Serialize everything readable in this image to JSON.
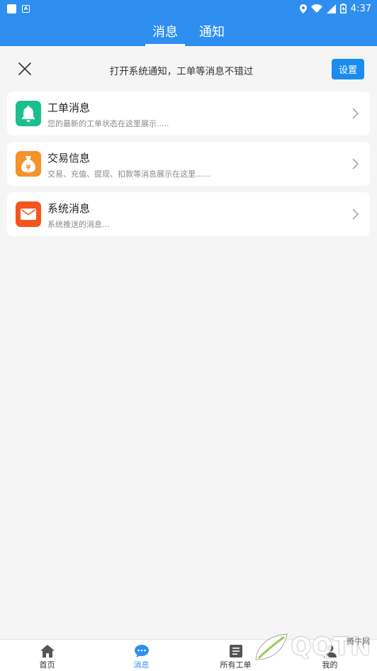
{
  "status": {
    "time": "4:37"
  },
  "header": {
    "tabs": [
      {
        "label": "消息"
      },
      {
        "label": "通知"
      }
    ]
  },
  "notice": {
    "text": "打开系统通知，工单等消息不错过",
    "button_label": "设置"
  },
  "messages": [
    {
      "title": "工单消息",
      "subtitle": "您的最新的工单状态在这里展示.....",
      "icon": "bell-icon",
      "color": "#1bbf8e"
    },
    {
      "title": "交易信息",
      "subtitle": "交易、充值、提现、扣款等消息展示在这里......",
      "icon": "money-bag-icon",
      "color": "#f5922a"
    },
    {
      "title": "系统消息",
      "subtitle": "系统推送的消息...",
      "icon": "mail-icon",
      "color": "#f3551c"
    }
  ],
  "nav": [
    {
      "label": "首页",
      "icon": "home-icon"
    },
    {
      "label": "消息",
      "icon": "chat-icon"
    },
    {
      "label": "所有工单",
      "icon": "list-icon"
    },
    {
      "label": "我的",
      "icon": "user-icon"
    }
  ],
  "watermark": {
    "logo": "QQTN",
    "site": "腾牛网"
  },
  "colors": {
    "primary": "#2f8ff0",
    "background": "#f5f5f5"
  }
}
